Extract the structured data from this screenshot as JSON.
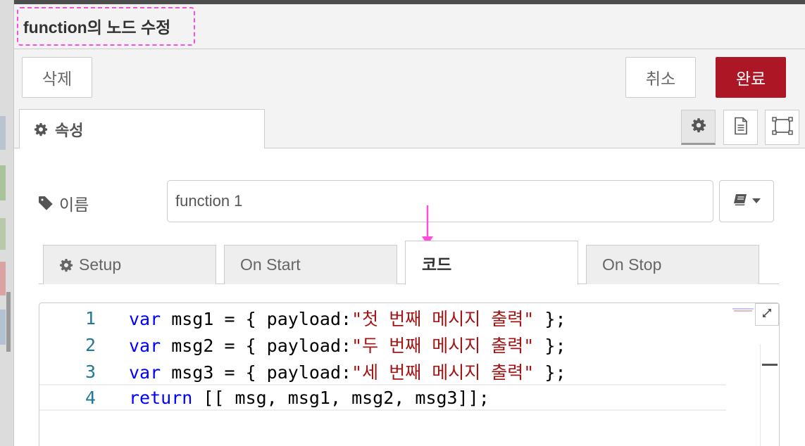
{
  "dialog": {
    "title": "function의 노드 수정",
    "buttons": {
      "delete": "삭제",
      "cancel": "취소",
      "done": "완료"
    }
  },
  "tabs": {
    "properties": "속성"
  },
  "name_field": {
    "label": "이름",
    "value": "function 1"
  },
  "subtabs": [
    {
      "label": "Setup"
    },
    {
      "label": "On Start"
    },
    {
      "label": "코드"
    },
    {
      "label": "On Stop"
    }
  ],
  "editor": {
    "lines": [
      {
        "num": "1",
        "kw": "var",
        "pre": " msg1 = { payload:",
        "str": "\"첫 번째 메시지 출력\"",
        "post": " };"
      },
      {
        "num": "2",
        "kw": "var",
        "pre": " msg2 = { payload:",
        "str": "\"두 번째 메시지 출력\"",
        "post": " };"
      },
      {
        "num": "3",
        "kw": "var",
        "pre": " msg3 = { payload:",
        "str": "\"세 번째 메시지 출력\"",
        "post": " };"
      },
      {
        "num": "4",
        "kw": "return",
        "pre": " [[ msg, msg1, msg2, msg3]];",
        "str": "",
        "post": ""
      }
    ]
  },
  "colors": {
    "accent": "#ad1625",
    "annotation": "#ff4fd8",
    "keyword": "#0000ff",
    "string": "#a31515",
    "line_number": "#237893"
  },
  "icons": {
    "properties_tab": "gear-icon",
    "description_tab": "document-icon",
    "appearance_tab": "frame-icon",
    "name_label": "tag-icon",
    "library": "book-icon",
    "setup_tab": "gear-icon",
    "expand": "expand-icon",
    "annotation": "arrow-down-icon"
  }
}
